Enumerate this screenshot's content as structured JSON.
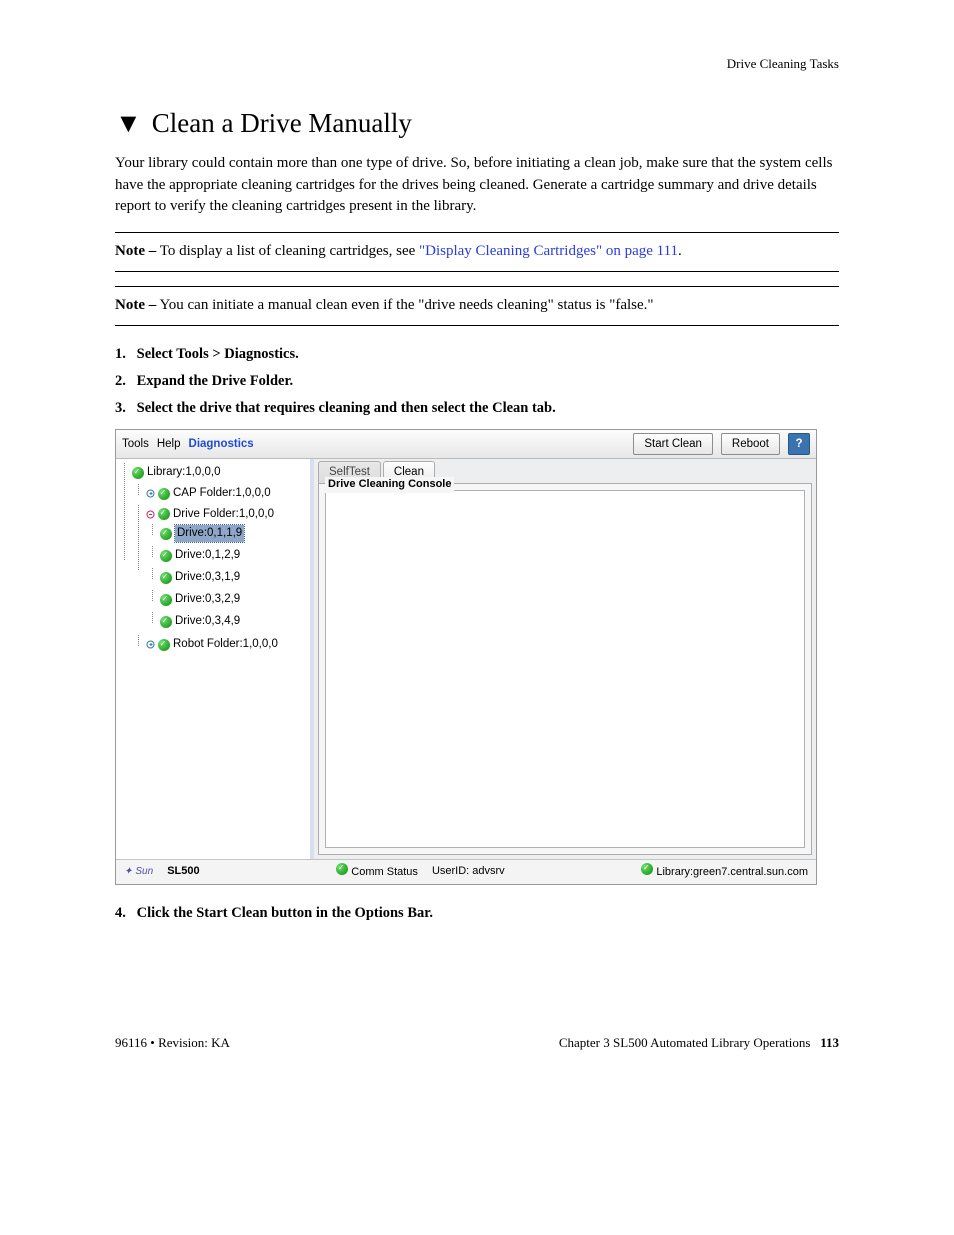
{
  "running_header": "Drive Cleaning Tasks",
  "title": "Clean a Drive Manually",
  "intro": "Your library could contain more than one type of drive. So, before initiating a clean job, make sure that the system cells have the appropriate cleaning cartridges for the drives being cleaned. Generate a cartridge summary and drive details report to verify the cleaning cartridges present in the library.",
  "note1": {
    "label": "Note –",
    "pre": " To display a list of cleaning cartridges, see ",
    "link": "\"Display Cleaning Cartridges\" on page 111",
    "post": "."
  },
  "note2": {
    "label": "Note –",
    "text": " You can initiate a manual clean even if the \"drive needs cleaning\" status is \"false.\""
  },
  "steps123": [
    "Select Tools > Diagnostics.",
    "Expand the Drive Folder.",
    "Select the drive that requires cleaning and then select the Clean tab."
  ],
  "step_numbers": [
    "1.",
    "2.",
    "3."
  ],
  "step4_num": "4.",
  "step4": "Click the Start Clean button in the Options Bar.",
  "app": {
    "menu_tools": "Tools",
    "menu_help": "Help",
    "menu_diag": "Diagnostics",
    "btn_start": "Start Clean",
    "btn_reboot": "Reboot",
    "help_symbol": "?",
    "tree": {
      "library": "Library:1,0,0,0",
      "cap": "CAP Folder:1,0,0,0",
      "drive_folder": "Drive Folder:1,0,0,0",
      "drives": [
        "Drive:0,1,1,9",
        "Drive:0,1,2,9",
        "Drive:0,3,1,9",
        "Drive:0,3,2,9",
        "Drive:0,3,4,9"
      ],
      "robot": "Robot Folder:1,0,0,0"
    },
    "tabs": {
      "self": "SelfTest",
      "clean": "Clean"
    },
    "legend": "Drive Cleaning Console",
    "status": {
      "sun": "Sun",
      "model": "SL500",
      "comm": "Comm Status",
      "user": "UserID: advsrv",
      "lib": "Library:green7.central.sun.com"
    }
  },
  "footer": {
    "left": "96116 • Revision: KA",
    "right_text": "Chapter 3 SL500 Automated Library Operations",
    "page": "113"
  }
}
